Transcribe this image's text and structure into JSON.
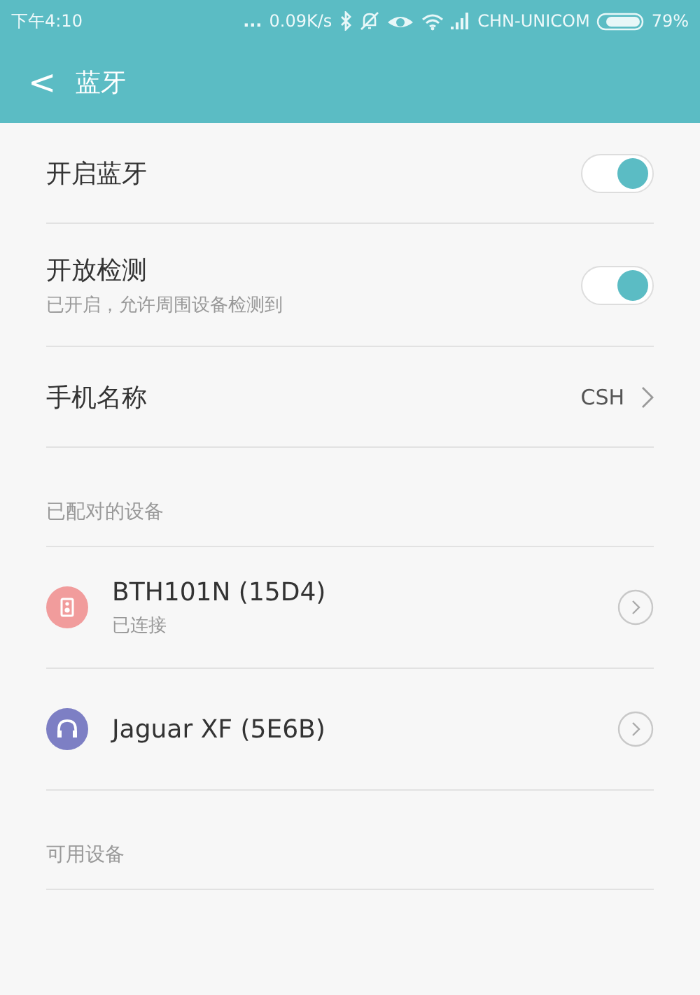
{
  "status_bar": {
    "time": "下午4:10",
    "dots": "...",
    "speed": "0.09K/s",
    "carrier": "CHN-UNICOM",
    "battery": "79%"
  },
  "header": {
    "back": "<",
    "title": "蓝牙"
  },
  "settings": [
    {
      "kind": "toggle",
      "label": "开启蓝牙",
      "on": true
    },
    {
      "kind": "toggle",
      "label": "开放检测",
      "sublabel": "已开启，允许周围设备检测到",
      "on": true
    },
    {
      "kind": "value",
      "label": "手机名称",
      "value": "CSH"
    }
  ],
  "paired_section": {
    "title": "已配对的设备",
    "devices": [
      {
        "kind": "speaker",
        "name": "BTH101N (15D4)",
        "status": "已连接",
        "color": "#f19c9c"
      },
      {
        "kind": "headset",
        "name": "Jaguar XF (5E6B)",
        "color": "#7d7fc4"
      }
    ]
  },
  "available_section": {
    "title": "可用设备"
  }
}
